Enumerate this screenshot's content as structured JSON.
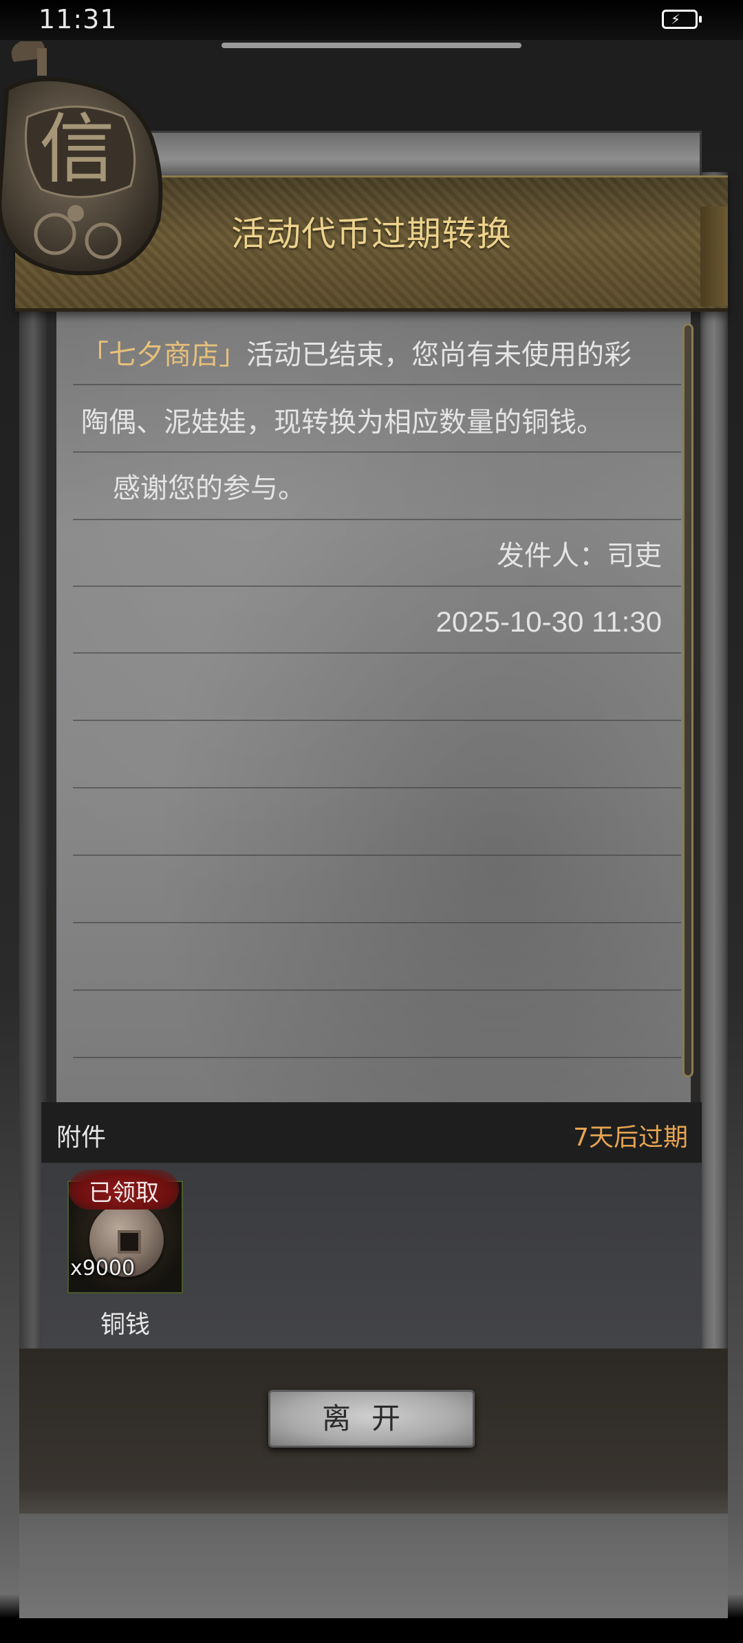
{
  "status_bar": {
    "time": "11:31"
  },
  "header": {
    "title": "活动代币过期转换",
    "seal_char": "信"
  },
  "mail": {
    "line1_highlight": "「七夕商店」",
    "line1_rest": "活动已结束，您尚有未使用的彩",
    "line2": "陶偶、泥娃娃，现转换为相应数量的铜钱。",
    "line3": "感谢您的参与。",
    "sender": "发件人：司吏",
    "datetime": "2025-10-30 11:30"
  },
  "attachment": {
    "label": "附件",
    "expire_text": "7天后过期",
    "items": [
      {
        "name": "铜钱",
        "count": "x9000",
        "status": "已领取"
      }
    ]
  },
  "actions": {
    "leave_label": "离开"
  },
  "colors": {
    "accent_gold": "#ecd28c",
    "highlight": "#e8c07a",
    "expire": "#e8a552",
    "claimed_red": "#8e1a1a"
  }
}
